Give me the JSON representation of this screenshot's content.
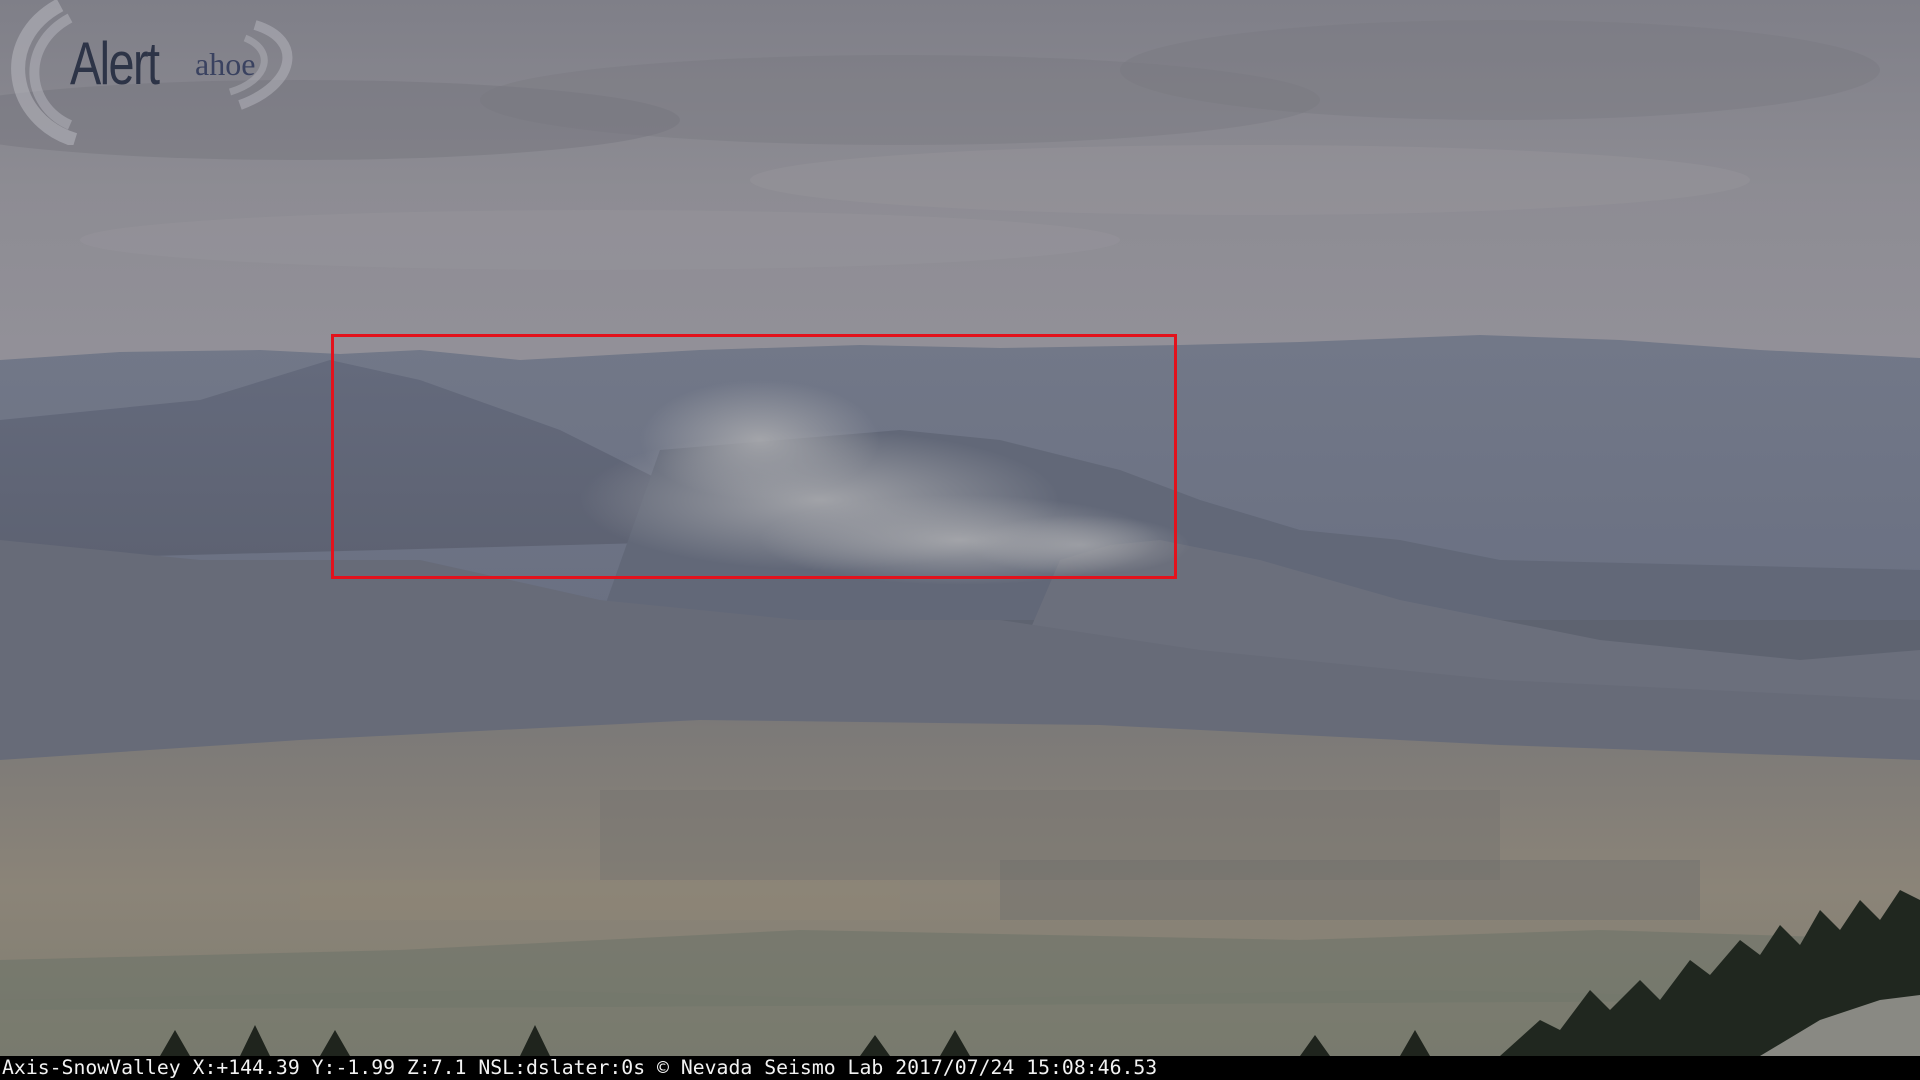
{
  "camera_feed": {
    "logo": {
      "word": "Alert",
      "suffix": "ahoe"
    },
    "overlay_caption": "Axis-SnowValley X:+144.39 Y:-1.99 Z:7.1 NSL:dslater:0s © Nevada Seismo Lab 2017/07/24 15:08:46.53",
    "detection_box_color": "#e3121c",
    "colors": {
      "sky": "#8b8b93",
      "distant_ridge": "#6e7585",
      "valley": "#8a8577",
      "caption_bg": "#000000",
      "caption_text": "#f2f2f2"
    }
  }
}
